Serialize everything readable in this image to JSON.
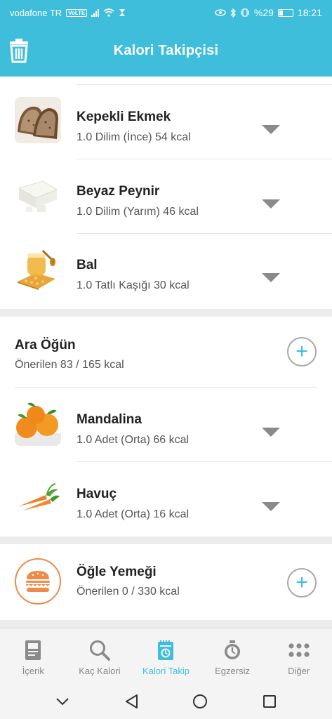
{
  "status_bar": {
    "carrier": "vodafone TR",
    "volte": "VoLTE",
    "battery": "%29",
    "time": "18:21"
  },
  "app_bar": {
    "title": "Kalori Takipçisi"
  },
  "breakfast_items": [
    {
      "name": "Kepekli Ekmek",
      "detail": "1.0 Dilim (İnce) 54 kcal",
      "image": "bread"
    },
    {
      "name": "Beyaz Peynir",
      "detail": "1.0 Dilim (Yarım) 46 kcal",
      "image": "cheese"
    },
    {
      "name": "Bal",
      "detail": "1.0 Tatlı Kaşığı 30 kcal",
      "image": "honey"
    }
  ],
  "snack": {
    "title": "Ara Öğün",
    "subtitle": "Önerilen 83 / 165 kcal",
    "items": [
      {
        "name": "Mandalina",
        "detail": "1.0 Adet (Orta) 66 kcal",
        "image": "tangerine"
      },
      {
        "name": "Havuç",
        "detail": "1.0 Adet (Orta) 16 kcal",
        "image": "carrot"
      }
    ]
  },
  "lunch": {
    "title": "Öğle Yemeği",
    "subtitle": "Önerilen 0 / 330 kcal",
    "icon": "burger-icon"
  },
  "bottom_nav": [
    {
      "label": "İçerik",
      "icon": "content-icon",
      "active": false
    },
    {
      "label": "Kaç Kalori",
      "icon": "search-icon",
      "active": false
    },
    {
      "label": "Kalori Takip",
      "icon": "calorie-tracker-icon",
      "active": true
    },
    {
      "label": "Egzersiz",
      "icon": "stopwatch-icon",
      "active": false
    },
    {
      "label": "Diğer",
      "icon": "more-icon",
      "active": false
    }
  ],
  "colors": {
    "accent": "#3ebedb",
    "meal_icon": "#f08a4b",
    "background": "#ececec"
  }
}
